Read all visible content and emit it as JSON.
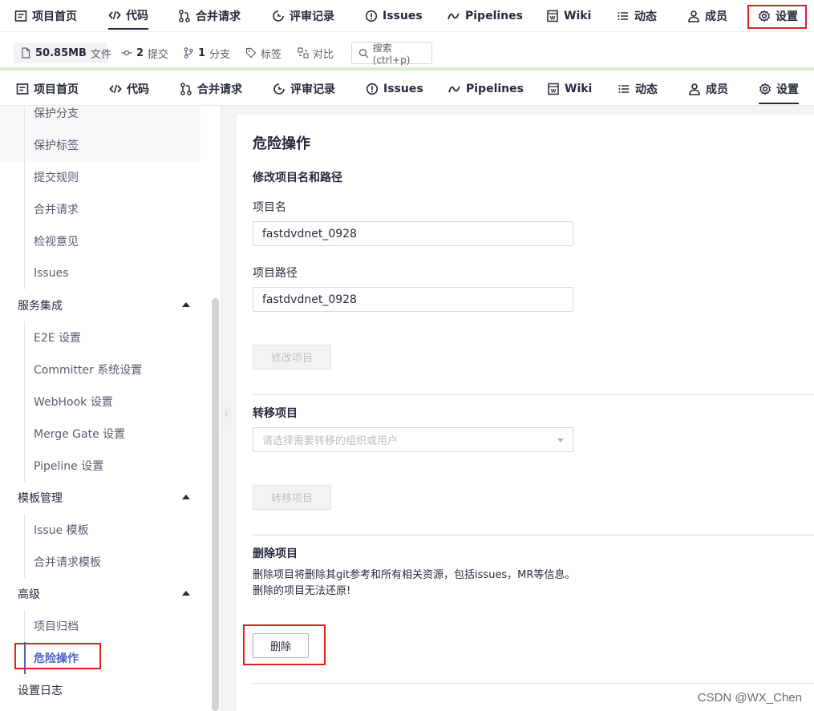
{
  "top_nav": {
    "items": [
      {
        "label": "项目首页",
        "icon": "project-home-icon"
      },
      {
        "label": "代码",
        "icon": "code-icon",
        "active": true
      },
      {
        "label": "合并请求",
        "icon": "merge-request-icon"
      },
      {
        "label": "评审记录",
        "icon": "review-record-icon"
      },
      {
        "label": "Issues",
        "icon": "issues-icon"
      },
      {
        "label": "Pipelines",
        "icon": "pipelines-icon"
      },
      {
        "label": "Wiki",
        "icon": "wiki-icon"
      },
      {
        "label": "动态",
        "icon": "activity-icon"
      },
      {
        "label": "成员",
        "icon": "members-icon"
      },
      {
        "label": "设置",
        "icon": "gear-icon",
        "highlighted": true
      }
    ]
  },
  "stats": {
    "size_value": "50.85MB",
    "size_label": "文件",
    "commits_value": "2",
    "commits_label": "提交",
    "branches_value": "1",
    "branches_label": "分支",
    "tags_label": "标签",
    "compare_label": "对比",
    "search_placeholder": "搜索 (ctrl+p)"
  },
  "second_nav": {
    "items": [
      {
        "label": "项目首页"
      },
      {
        "label": "代码"
      },
      {
        "label": "合并请求"
      },
      {
        "label": "评审记录"
      },
      {
        "label": "Issues"
      },
      {
        "label": "Pipelines"
      },
      {
        "label": "Wiki"
      },
      {
        "label": "动态"
      },
      {
        "label": "成员"
      },
      {
        "label": "设置",
        "active": true
      }
    ]
  },
  "sidebar": {
    "items": [
      {
        "label": "保护分支",
        "type": "sub",
        "shaded": true
      },
      {
        "label": "保护标签",
        "type": "sub",
        "shaded": true
      },
      {
        "label": "提交规则",
        "type": "sub"
      },
      {
        "label": "合并请求",
        "type": "sub"
      },
      {
        "label": "检视意见",
        "type": "sub"
      },
      {
        "label": "Issues",
        "type": "sub"
      },
      {
        "label": "服务集成",
        "type": "group"
      },
      {
        "label": "E2E 设置",
        "type": "sub"
      },
      {
        "label": "Committer 系统设置",
        "type": "sub"
      },
      {
        "label": "WebHook 设置",
        "type": "sub"
      },
      {
        "label": "Merge Gate 设置",
        "type": "sub"
      },
      {
        "label": "Pipeline 设置",
        "type": "sub"
      },
      {
        "label": "模板管理",
        "type": "group"
      },
      {
        "label": "Issue 模板",
        "type": "sub"
      },
      {
        "label": "合并请求模板",
        "type": "sub"
      },
      {
        "label": "高级",
        "type": "group"
      },
      {
        "label": "项目归档",
        "type": "sub"
      },
      {
        "label": "危险操作",
        "type": "sub",
        "active": true
      },
      {
        "label": "设置日志",
        "type": "group"
      }
    ]
  },
  "main": {
    "page_title": "危险操作",
    "rename_section": {
      "title": "修改项目名和路径",
      "name_label": "项目名",
      "name_value": "fastdvdnet_0928",
      "path_label": "项目路径",
      "path_value": "fastdvdnet_0928",
      "submit_label": "修改项目"
    },
    "transfer_section": {
      "title": "转移项目",
      "select_placeholder": "请选择需要转移的组织或用户",
      "submit_label": "转移项目"
    },
    "delete_section": {
      "title": "删除项目",
      "desc_line1": "删除项目将删除其git参考和所有相关资源，包括issues，MR等信息。",
      "desc_line2": "删除的项目无法还原!",
      "delete_label": "删除"
    }
  },
  "watermark": "CSDN @WX_Chen",
  "colors": {
    "highlight": "#e02020",
    "active_link": "#4b63c4",
    "green_bar": "#d9efd0"
  }
}
